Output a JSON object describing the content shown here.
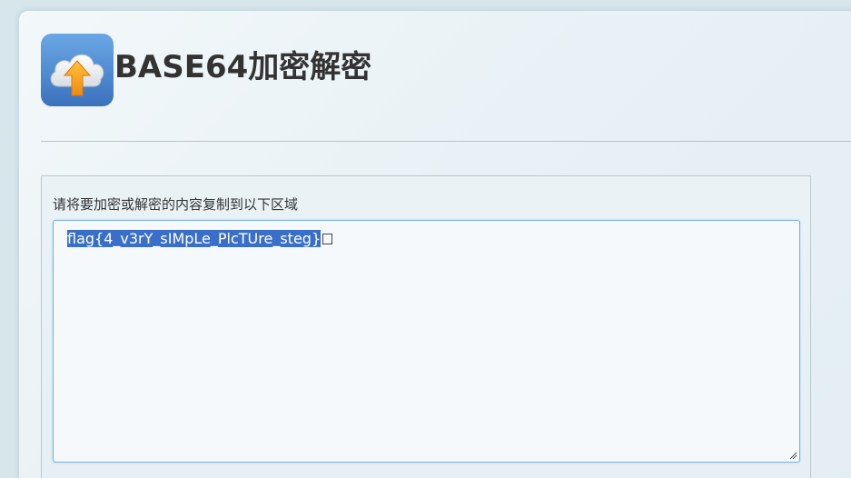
{
  "page": {
    "title": "BASE64加密解密",
    "logo_icon": "cloud-upload-icon"
  },
  "form": {
    "label": "请将要加密或解密的内容复制到以下区域",
    "textarea_value": "flag{4_v3rY_sIMpLe_PlcTUre_steg}",
    "trailing_glyph": "unknown-character-box"
  },
  "colors": {
    "selection": "#3a6fc9",
    "textarea_border": "#7ab2e0",
    "title": "#333333",
    "logo_bg": "#4a86d0",
    "arrow": "#f7a21b"
  }
}
